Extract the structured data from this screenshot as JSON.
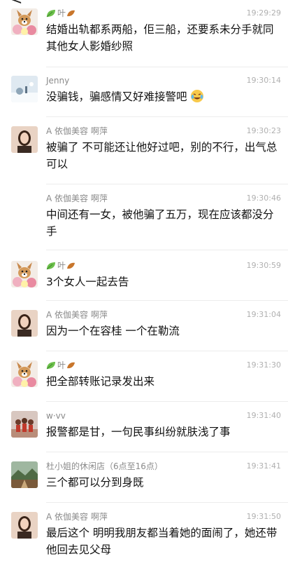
{
  "header": {
    "back_glyph": "<",
    "more_glyph": "•••"
  },
  "messages": [
    {
      "name": "叶",
      "time": "19:29:29",
      "text": "结婚出轨都系两船，佢三船，还要系未分手就同其他女人影婚纱照",
      "avatar_icon": "dog-flowers-avatar",
      "name_icons": "leaf-icon"
    },
    {
      "name": "Jenny",
      "time": "19:30:14",
      "text": "没骗钱，骗感情又好难接警吧",
      "avatar_icon": "snow-scene-avatar",
      "emoji": "laughing-tears-emoji"
    },
    {
      "name": "A    依伽美容 啊萍",
      "time": "19:30:23",
      "text": "被骗了 不可能还让他好过吧，别的不行，出气总可以",
      "avatar_icon": "woman-portrait-avatar"
    },
    {
      "name": "A    依伽美容 啊萍",
      "time": "19:30:46",
      "text": "中间还有一女，被他骗了五万，现在应该都没分手"
    },
    {
      "name": "叶",
      "time": "19:30:59",
      "text": "3个女人一起去告",
      "avatar_icon": "dog-flowers-avatar",
      "name_icons": "leaf-icon"
    },
    {
      "name": "A    依伽美容 啊萍",
      "time": "19:31:04",
      "text": "因为一个在容桂 一个在勒流",
      "avatar_icon": "woman-portrait-avatar"
    },
    {
      "name": "叶",
      "time": "19:31:30",
      "text": "把全部转账记录发出来",
      "avatar_icon": "dog-flowers-avatar",
      "name_icons": "leaf-icon"
    },
    {
      "name": "w·vv",
      "time": "19:31:40",
      "text": "报警都是甘，一句民事纠纷就肤浅了事",
      "avatar_icon": "group-photo-avatar"
    },
    {
      "name": "杜小姐的休闲店（6点至16点）",
      "time": "19:31:41",
      "text": "三个都可以分到身既",
      "avatar_icon": "landscape-avatar"
    },
    {
      "name": "A    依伽美容 啊萍",
      "time": "19:31:50",
      "text": "最后这个 明明我朋友都当着她的面闹了，她还带他回去见父母",
      "avatar_icon": "woman-portrait-avatar"
    }
  ],
  "colors": {
    "background": "#ffffff",
    "name": "#8a8a8a",
    "time": "#b0b0b0",
    "text": "#111111"
  }
}
